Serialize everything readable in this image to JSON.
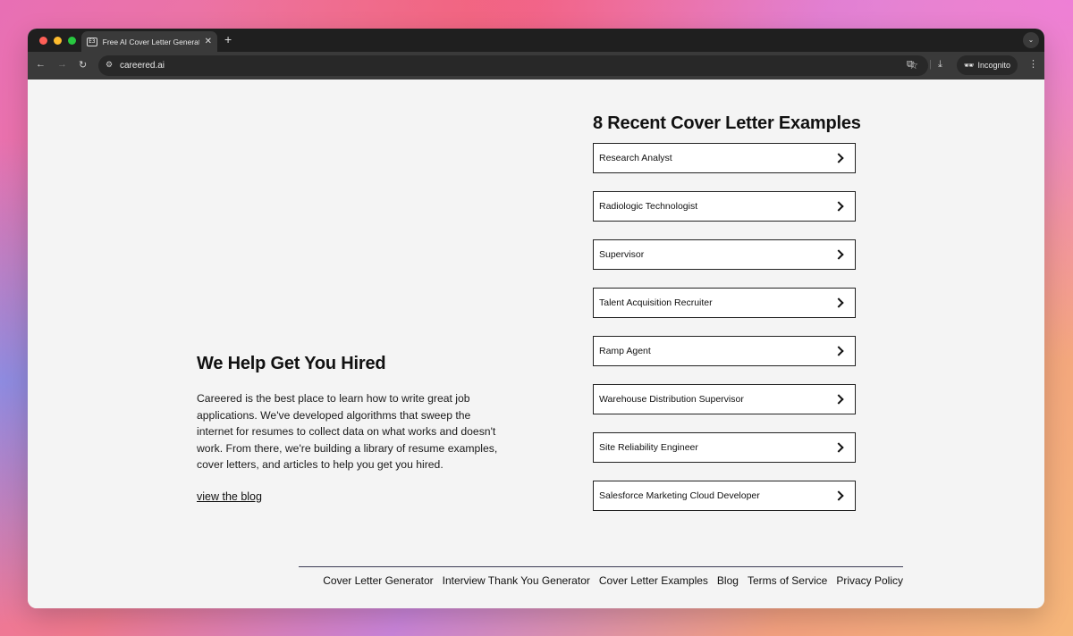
{
  "browser": {
    "tab_title": "Free AI Cover Letter Generator",
    "tab_favicon": "E3",
    "url": "careered.ai",
    "incognito_label": "Incognito"
  },
  "about": {
    "heading": "We Help Get You Hired",
    "body": "Careered is the best place to learn how to write great job applications. We've developed algorithms that sweep the internet for resumes to collect data on what works and doesn't work. From there, we're building a library of resume examples, cover letters, and articles to help you get you hired.",
    "blog_link": "view the blog"
  },
  "examples": {
    "heading": "8 Recent Cover Letter Examples",
    "items": [
      "Research Analyst",
      "Radiologic Technologist",
      "Supervisor",
      "Talent Acquisition Recruiter",
      "Ramp Agent",
      "Warehouse Distribution Supervisor",
      "Site Reliability Engineer",
      "Salesforce Marketing Cloud Developer"
    ]
  },
  "footer": {
    "links": [
      "Cover Letter Generator",
      "Interview Thank You Generator",
      "Cover Letter Examples",
      "Blog",
      "Terms of Service",
      "Privacy Policy"
    ]
  }
}
